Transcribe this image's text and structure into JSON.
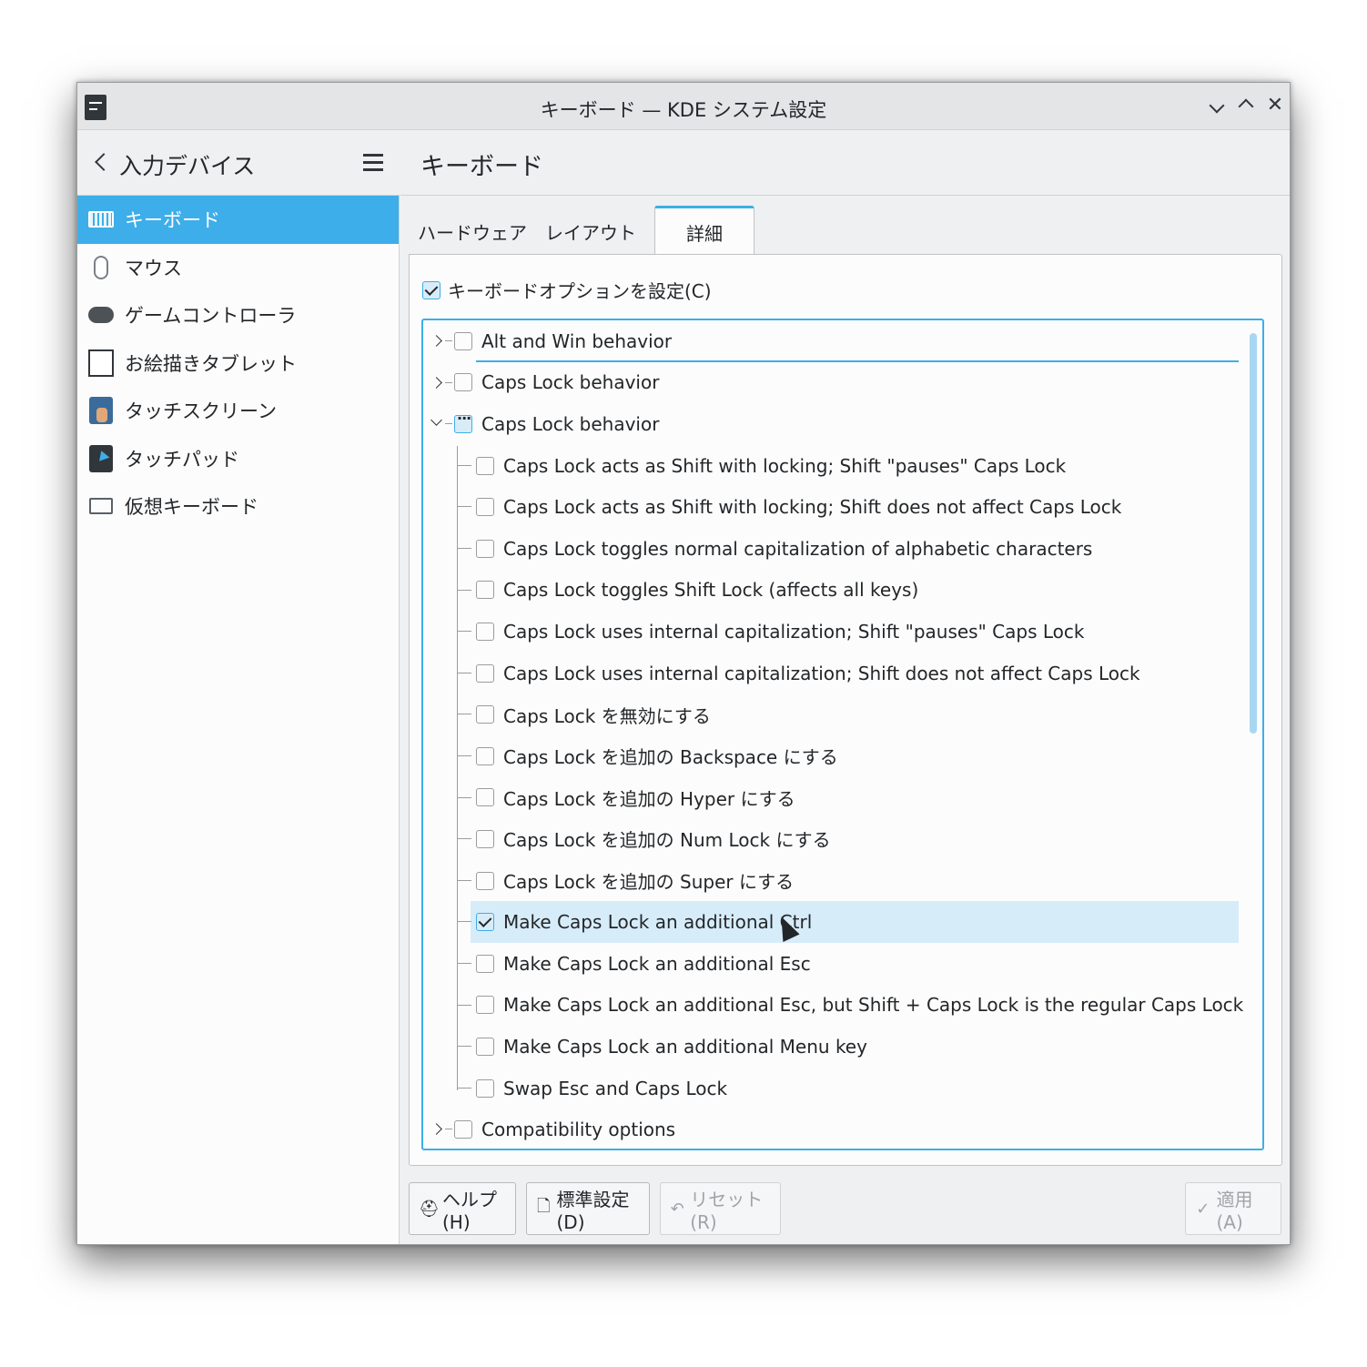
{
  "window": {
    "title": "キーボード — KDE システム設定"
  },
  "sidebar": {
    "title": "入力デバイス",
    "items": [
      {
        "label": "キーボード",
        "icon": "keyboard-icon",
        "active": true
      },
      {
        "label": "マウス",
        "icon": "mouse-icon"
      },
      {
        "label": "ゲームコントローラ",
        "icon": "gamepad-icon"
      },
      {
        "label": "お絵描きタブレット",
        "icon": "tablet-icon"
      },
      {
        "label": "タッチスクリーン",
        "icon": "touchscreen-icon"
      },
      {
        "label": "タッチパッド",
        "icon": "touchpad-icon"
      },
      {
        "label": "仮想キーボード",
        "icon": "virtual-keyboard-icon"
      }
    ]
  },
  "main": {
    "title": "キーボード",
    "tabs": [
      {
        "label": "ハードウェア"
      },
      {
        "label": "レイアウト"
      },
      {
        "label": "詳細",
        "active": true
      }
    ],
    "enable_options_label": "キーボードオプションを設定(C)",
    "tree": [
      {
        "label": "Alt and Win behavior",
        "level": 0,
        "state": "unchecked",
        "expander": "closed"
      },
      {
        "label": "Caps Lock behavior",
        "level": 0,
        "state": "unchecked",
        "expander": "closed"
      },
      {
        "label": "Caps Lock behavior",
        "level": 0,
        "state": "partial",
        "expander": "open"
      },
      {
        "label": "Caps Lock acts as Shift with locking; Shift \"pauses\" Caps Lock",
        "level": 1,
        "state": "unchecked"
      },
      {
        "label": "Caps Lock acts as Shift with locking; Shift does not affect Caps Lock",
        "level": 1,
        "state": "unchecked"
      },
      {
        "label": "Caps Lock toggles normal capitalization of alphabetic characters",
        "level": 1,
        "state": "unchecked"
      },
      {
        "label": "Caps Lock toggles Shift Lock (affects all keys)",
        "level": 1,
        "state": "unchecked"
      },
      {
        "label": "Caps Lock uses internal capitalization; Shift \"pauses\" Caps Lock",
        "level": 1,
        "state": "unchecked"
      },
      {
        "label": "Caps Lock uses internal capitalization; Shift does not affect Caps Lock",
        "level": 1,
        "state": "unchecked"
      },
      {
        "label": "Caps Lock を無効にする",
        "level": 1,
        "state": "unchecked"
      },
      {
        "label": "Caps Lock を追加の Backspace にする",
        "level": 1,
        "state": "unchecked"
      },
      {
        "label": "Caps Lock を追加の Hyper にする",
        "level": 1,
        "state": "unchecked"
      },
      {
        "label": "Caps Lock を追加の Num Lock にする",
        "level": 1,
        "state": "unchecked"
      },
      {
        "label": "Caps Lock を追加の Super にする",
        "level": 1,
        "state": "unchecked"
      },
      {
        "label": "Make Caps Lock an additional Ctrl",
        "level": 1,
        "state": "checked"
      },
      {
        "label": "Make Caps Lock an additional Esc",
        "level": 1,
        "state": "unchecked"
      },
      {
        "label": "Make Caps Lock an additional Esc, but Shift + Caps Lock is the regular Caps Lock",
        "level": 1,
        "state": "unchecked"
      },
      {
        "label": "Make Caps Lock an additional Menu key",
        "level": 1,
        "state": "unchecked"
      },
      {
        "label": "Swap Esc and Caps Lock",
        "level": 1,
        "state": "unchecked"
      },
      {
        "label": "Compatibility options",
        "level": 0,
        "state": "unchecked",
        "expander": "closed"
      }
    ]
  },
  "footer": {
    "help_label": "ヘルプ(H)",
    "defaults_label": "標準設定(D)",
    "reset_label": "リセット(R)",
    "apply_label": "適用(A)"
  },
  "colors": {
    "accent": "#3daee9",
    "hover_row": "#d7ecf9",
    "window_bg": "#eff0f1"
  }
}
